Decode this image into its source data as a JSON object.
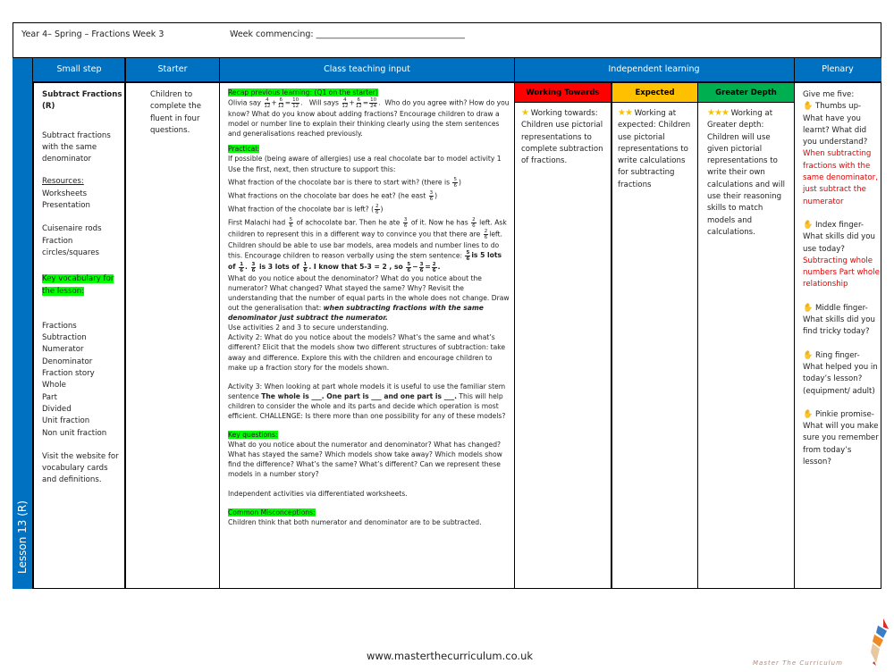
{
  "header": {
    "title": "Year 4– Spring – Fractions  Week 3",
    "week_commencing_label": "Week commencing: ___________________________________"
  },
  "columns": {
    "small_step": "Small step",
    "starter": "Starter",
    "teaching": "Class teaching input",
    "independent": "Independent learning",
    "plenary": "Plenary"
  },
  "sub_columns": {
    "working_towards": "Working Towards",
    "expected": "Expected",
    "greater_depth": "Greater Depth"
  },
  "colors": {
    "header_blue": "#0070c0",
    "working_towards": "#ff0000",
    "expected": "#ffc000",
    "greater_depth": "#00b050",
    "highlight": "#00ff00",
    "plenary_answer": "#e00000"
  },
  "lesson_label": "Lesson 13 (R)",
  "small_step": {
    "title": "Subtract Fractions (R)",
    "description": "Subtract fractions with the same denominator",
    "resources_label": "Resources:",
    "resources": [
      "Worksheets",
      "Presentation"
    ],
    "equipment": [
      "Cuisenaire rods",
      "Fraction circles/squares"
    ],
    "vocab_label": "Key vocabulary for the lesson:",
    "vocabulary": [
      "Fractions",
      "Subtraction",
      "Numerator",
      "Denominator",
      "Fraction story",
      "Whole",
      "Part",
      "Divided",
      "Unit fraction",
      "Non unit fraction"
    ],
    "website_note": "Visit the website for vocabulary cards and definitions."
  },
  "starter": {
    "text": "Children to complete the fluent in four questions."
  },
  "teaching": {
    "recap_label": "Recap previous learning: (Q1 on the starter)",
    "recap_olivia": "Olivia say",
    "recap_will": "Will says",
    "recap_question": "Who do you agree with?",
    "recap_rest": "How do you know?  What do you know about adding fractions?  Encourage children to draw a model or number line to explain their thinking clearly using the stem sentences and generalisations reached previously.",
    "practical_label": "Practical:",
    "practical_intro": "If possible (being aware of allergies) use a real chocolate bar to model activity 1 Use the first, next, then structure to support this:",
    "q1": "What fraction of the chocolate bar is there to start with? (there is",
    "q2": "What fractions on the chocolate bar does he eat?  (he east",
    "q3": "What fraction of the chocolate bar is left? (",
    "story_a": "First Malachi had",
    "story_b": "of achocolate bar.  Then he ate",
    "story_c": "of it.   Now he has",
    "story_d": "left. Ask children to represent this in a different way to convince you that there are",
    "story_e": "left.  Children should be able to use bar models, area models and number lines to do this.  Encourage children to reason verbally using the stem sentence:",
    "stem_1": "is 5 lots of",
    "stem_2": "is 3 lots of",
    "stem_3": "I know that 5-3 = 2 , so",
    "notice": "What do you notice about the denominator? What do you notice about the numerator?  What changed? What stayed the same?  Why?  Revisit the understanding that the  number of equal parts in the whole does not change. Draw out the generalisation that:",
    "generalisation": "when subtracting fractions with the same denominator just subtract the numerator.",
    "use_activities": "Use activities 2 and 3 to secure understanding.",
    "activity2": "Activity 2:  What do you notice about the models?  What’s the same and what’s different?  Elicit that the models show two different structures of subtraction: take away and difference.  Explore this with the children and encourage children to make up a fraction story for the models shown.",
    "activity3_a": "Activity 3:  When looking at part whole models it is useful to use the familiar stem sentence",
    "activity3_stem": "The whole is ___. One part is ___ and one part is ___.",
    "activity3_b": "This will help children to consider the whole and its parts and decide which operation is most efficient.  CHALLENGE:    Is there more than one possibility for any of these models?",
    "key_questions_label": "Key questions:",
    "key_questions": "What do you notice about the numerator and denominator? What has changed?  What has stayed the same? Which models show take away? Which models show find the difference? What’s the same? What’s different?  Can we represent these models in a number story?",
    "independent_note": "Independent activities via differentiated worksheets.",
    "misconceptions_label": "Common Misconceptions:",
    "misconceptions": "Children think that both numerator and denominator are to be subtracted."
  },
  "independent": {
    "working_towards": {
      "stars": "★",
      "text": "Working towards: Children use pictorial representations to complete subtraction of fractions."
    },
    "expected": {
      "stars": "★★",
      "text": "Working at expected: Children use pictorial representations to write calculations for subtracting fractions"
    },
    "greater_depth": {
      "stars": "★★★",
      "text": "Working at Greater depth: Children will use given pictorial representations to write their own calculations and will use their reasoning skills to match models and calculations."
    }
  },
  "plenary": {
    "intro": "Give me five:",
    "items": [
      {
        "icon": "✋",
        "prompt": "Thumbs up- What have you learnt? What did you understand?",
        "answer": "When subtracting fractions with the same denominator, just subtract the numerator"
      },
      {
        "icon": "✋",
        "prompt": "Index finger- What skills did you use today?",
        "answer": "Subtracting whole numbers Part whole relationship"
      },
      {
        "icon": "✋",
        "prompt": "Middle finger- What skills did you find tricky today?",
        "answer": ""
      },
      {
        "icon": "✋",
        "prompt": "Ring finger- What helped you in today’s lesson? (equipment/ adult)",
        "answer": ""
      },
      {
        "icon": "✋",
        "prompt": "Pinkie promise- What will you make sure you remember from today’s lesson?",
        "answer": ""
      }
    ]
  },
  "footer": {
    "url": "www.masterthecurriculum.co.uk",
    "logo_text": "Master The Curriculum"
  }
}
